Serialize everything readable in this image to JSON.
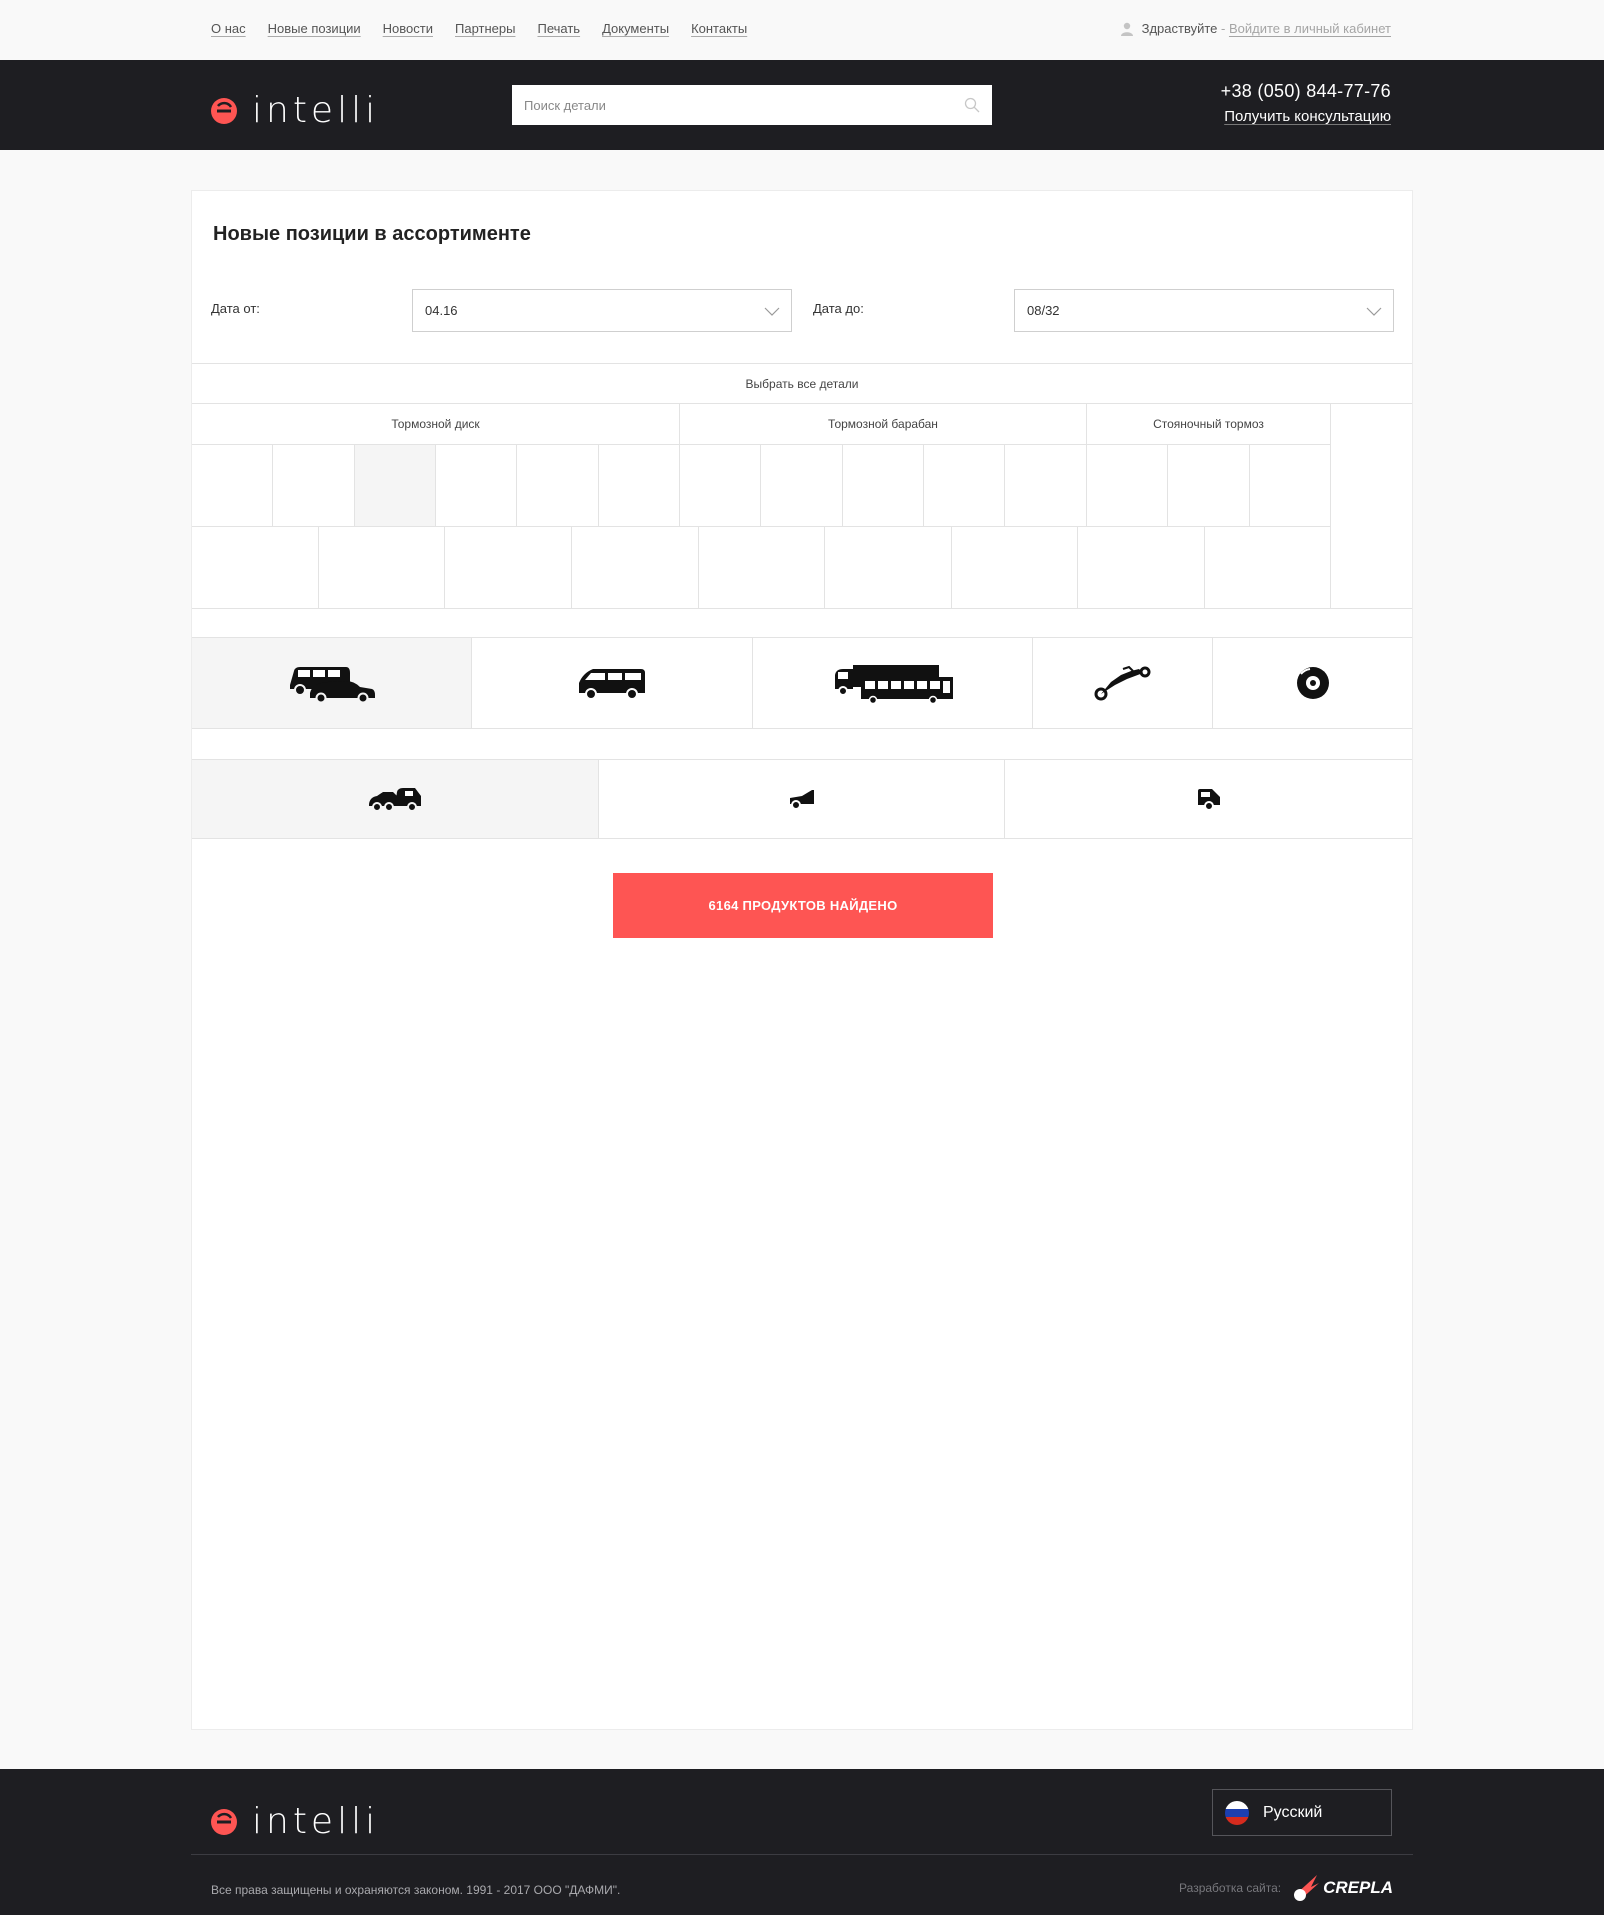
{
  "topnav": {
    "links": [
      "О нас",
      "Новые позиции",
      "Новости",
      "Партнеры",
      "Печать",
      "Документы",
      "Контакты"
    ],
    "greeting": "Здраствуйте",
    "separator": " - ",
    "login_link": "Войдите в личный кабинет"
  },
  "header": {
    "logo_text": "intelli",
    "search_placeholder": "Поиск детали",
    "phone": "+38 (050) 844-77-76",
    "consult_link": "Получить консультацию"
  },
  "main": {
    "title": "Новые позиции в ассортименте",
    "date_from_label": "Дата от:",
    "date_from_value": "04.16",
    "date_to_label": "Дата до:",
    "date_to_value": "08/32",
    "select_all": "Выбрать все детали",
    "categories": [
      "Тормозной диск",
      "Тормозной барабан",
      "Стояночный тормоз"
    ],
    "vehicle_types": [
      "cars-and-van-icon",
      "minivan-icon",
      "truck-and-bus-icon",
      "motorcycle-icon",
      "brake-disc-icon"
    ],
    "body_types": [
      "car-pair-icon",
      "sedan-front-icon",
      "suv-rear-icon"
    ],
    "result_button": "6164 ПРОДУКТОВ НАЙДЕНО"
  },
  "footer": {
    "logo_text": "intelli",
    "language": "Русский",
    "copyright": "Все права защищены и охраняются законом. 1991 - 2017 ООО \"ДАФМИ\".",
    "dev_label": "Разработка сайта:",
    "dev_brand": "CREPLA"
  },
  "colors": {
    "accent": "#fe5553",
    "dark": "#1e1e22"
  }
}
